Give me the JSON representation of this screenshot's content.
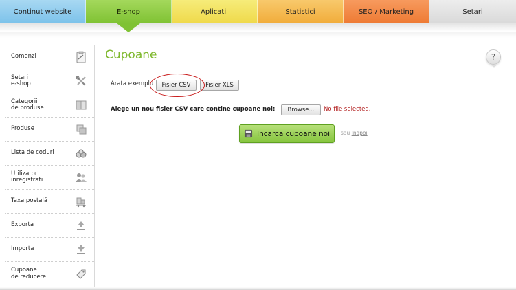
{
  "nav": {
    "tabs": [
      {
        "label": "Continut website"
      },
      {
        "label": "E-shop"
      },
      {
        "label": "Aplicatii"
      },
      {
        "label": "Statistici"
      },
      {
        "label": "SEO / Marketing"
      },
      {
        "label": "Setari"
      }
    ],
    "active_tab": "E-shop"
  },
  "sidebar": {
    "items": [
      {
        "label": "Comenzi",
        "icon": "clipboard-icon"
      },
      {
        "label": "Setari\ne-shop",
        "icon": "tools-icon"
      },
      {
        "label": "Categorii\nde produse",
        "icon": "book-icon"
      },
      {
        "label": "Produse",
        "icon": "boxes-icon"
      },
      {
        "label": "Lista de coduri",
        "icon": "coins-icon"
      },
      {
        "label": "Utilizatori\ninregistrati",
        "icon": "users-icon"
      },
      {
        "label": "Taxa postală",
        "icon": "cart-icon"
      },
      {
        "label": "Exporta",
        "icon": "export-icon"
      },
      {
        "label": "Importa",
        "icon": "import-icon"
      },
      {
        "label": "Cupoane\nde reducere",
        "icon": "tag-icon"
      }
    ]
  },
  "page": {
    "title": "Cupoane",
    "help_label": "?",
    "sample_label": "Arata exemplu",
    "csv_button": "Fisier CSV",
    "xls_button": "Fisier XLS",
    "file_label": "Alege un nou fisier CSV care contine cupoane noi:",
    "browse_button": "Browse...",
    "file_status": "No file selected.",
    "upload_button": "Incarca cupoane noi",
    "or_text": "sau",
    "back_link": "Inapoi"
  },
  "colors": {
    "title_green": "#7fb82e",
    "active_tab_green": "#7fc233",
    "highlight_red": "#c81818",
    "error_text": "#b21d1d"
  }
}
